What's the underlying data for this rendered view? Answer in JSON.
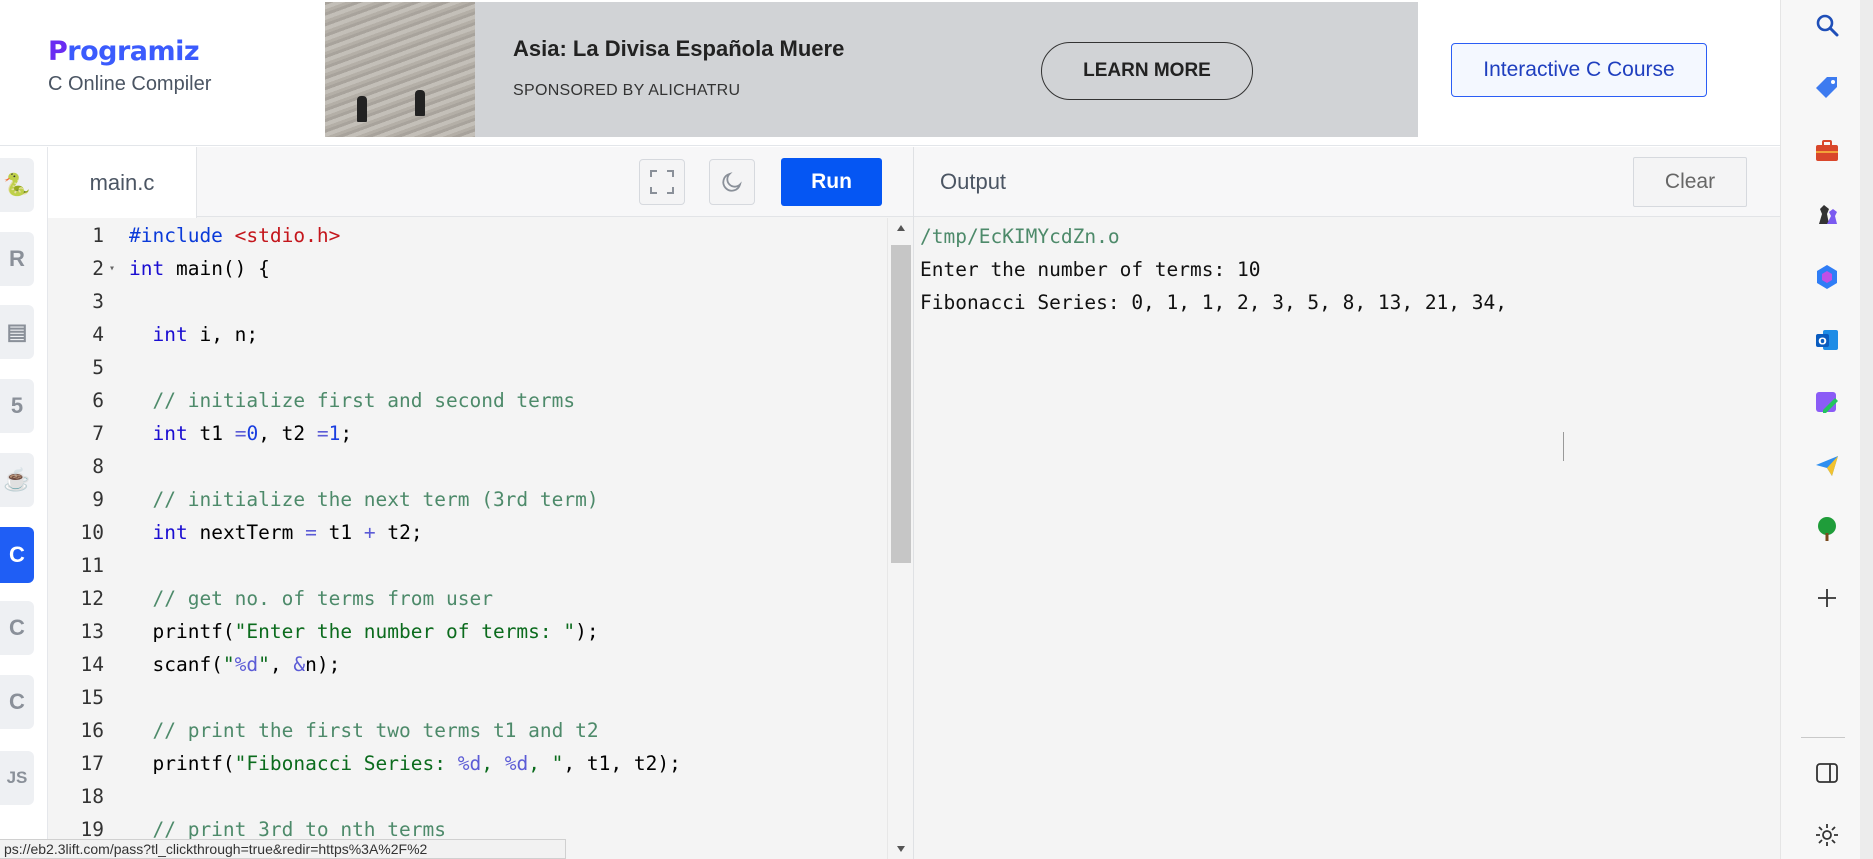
{
  "brand": {
    "name": "Programiz",
    "subtitle": "C Online Compiler"
  },
  "ad": {
    "title": "Asia: La Divisa Española Muere",
    "sponsor": "SPONSORED BY ALICHATRU",
    "cta": "LEARN MORE"
  },
  "header": {
    "course_button": "Interactive C Course"
  },
  "rail": [
    {
      "name": "python-icon",
      "glyph": "🐍",
      "active": false
    },
    {
      "name": "r-icon",
      "glyph": "R",
      "active": false
    },
    {
      "name": "sql-icon",
      "glyph": "▤",
      "active": false
    },
    {
      "name": "html-icon",
      "glyph": "5",
      "active": false
    },
    {
      "name": "java-icon",
      "glyph": "☕",
      "active": false
    },
    {
      "name": "c-icon",
      "glyph": "C",
      "active": true
    },
    {
      "name": "cpp-icon",
      "glyph": "C",
      "active": false
    },
    {
      "name": "csharp-icon",
      "glyph": "C",
      "active": false
    },
    {
      "name": "js-icon",
      "glyph": "JS",
      "active": false
    }
  ],
  "editor": {
    "tab": "main.c",
    "run_label": "Run",
    "scroll_position": 0.06,
    "scroll_visible_fraction": 0.53,
    "lines": [
      {
        "n": "1",
        "fold": false,
        "tokens": [
          [
            "pp",
            "#include "
          ],
          [
            "inc",
            "<stdio.h>"
          ]
        ]
      },
      {
        "n": "2",
        "fold": true,
        "tokens": [
          [
            "kw",
            "int"
          ],
          [
            "",
            "main() {"
          ]
        ]
      },
      {
        "n": "3",
        "fold": false,
        "tokens": []
      },
      {
        "n": "4",
        "fold": false,
        "tokens": [
          [
            "",
            "  "
          ],
          [
            "kw",
            "int"
          ],
          [
            "",
            "i, n;"
          ]
        ]
      },
      {
        "n": "5",
        "fold": false,
        "tokens": []
      },
      {
        "n": "6",
        "fold": false,
        "tokens": [
          [
            "",
            "  "
          ],
          [
            "cm",
            "// initialize first and second terms"
          ]
        ]
      },
      {
        "n": "7",
        "fold": false,
        "tokens": [
          [
            "",
            "  "
          ],
          [
            "kw",
            "int"
          ],
          [
            "",
            " t1 "
          ],
          [
            "fmt",
            "="
          ],
          [
            "",
            ""
          ],
          [
            "num",
            "0"
          ],
          [
            "",
            ", t2 "
          ],
          [
            "fmt",
            "="
          ],
          [
            "num",
            "1"
          ],
          [
            "",
            ";"
          ]
        ]
      },
      {
        "n": "8",
        "fold": false,
        "tokens": []
      },
      {
        "n": "9",
        "fold": false,
        "tokens": [
          [
            "",
            "  "
          ],
          [
            "cm",
            "// initialize the next term (3rd term)"
          ]
        ]
      },
      {
        "n": "10",
        "fold": false,
        "tokens": [
          [
            "",
            "  "
          ],
          [
            "kw",
            "int"
          ],
          [
            "",
            " nextTerm "
          ],
          [
            "fmt",
            "="
          ],
          [
            "",
            " t1 "
          ],
          [
            "fmt",
            "+"
          ],
          [
            "",
            " t2;"
          ]
        ]
      },
      {
        "n": "11",
        "fold": false,
        "tokens": []
      },
      {
        "n": "12",
        "fold": false,
        "tokens": [
          [
            "",
            "  "
          ],
          [
            "cm",
            "// get no. of terms from user"
          ]
        ]
      },
      {
        "n": "13",
        "fold": false,
        "tokens": [
          [
            "",
            "  printf("
          ],
          [
            "str",
            "\"Enter the number of terms: \""
          ],
          [
            "",
            ");"
          ]
        ]
      },
      {
        "n": "14",
        "fold": false,
        "tokens": [
          [
            "",
            "  scanf("
          ],
          [
            "str",
            "\""
          ],
          [
            "fmt",
            "%d"
          ],
          [
            "str",
            "\""
          ],
          [
            "",
            ", "
          ],
          [
            "fmt",
            "&"
          ],
          [
            "",
            "n);"
          ]
        ]
      },
      {
        "n": "15",
        "fold": false,
        "tokens": []
      },
      {
        "n": "16",
        "fold": false,
        "tokens": [
          [
            "",
            "  "
          ],
          [
            "cm",
            "// print the first two terms t1 and t2"
          ]
        ]
      },
      {
        "n": "17",
        "fold": false,
        "tokens": [
          [
            "",
            "  printf("
          ],
          [
            "str",
            "\"Fibonacci Series: "
          ],
          [
            "fmt",
            "%d"
          ],
          [
            "str",
            ", "
          ],
          [
            "fmt",
            "%d"
          ],
          [
            "str",
            ", \""
          ],
          [
            "",
            ", t1, t2);"
          ]
        ]
      },
      {
        "n": "18",
        "fold": false,
        "tokens": []
      },
      {
        "n": "19",
        "fold": false,
        "tokens": [
          [
            "",
            "  "
          ],
          [
            "cm",
            "// print 3rd to nth terms"
          ]
        ]
      }
    ]
  },
  "output": {
    "title": "Output",
    "clear_label": "Clear",
    "path": "/tmp/EcKIMYcdZn.o",
    "lines": [
      "Enter the number of terms: 10",
      "Fibonacci Series: 0, 1, 1, 2, 3, 5, 8, 13, 21, 34, "
    ]
  },
  "status_url": "ps://eb2.3lift.com/pass?tl_clickthrough=true&redir=https%3A%2F%2",
  "rightbar": [
    "search-icon",
    "tag-icon",
    "toolbox-icon",
    "chess-icon",
    "copilot-icon",
    "outlook-icon",
    "designer-icon",
    "send-icon",
    "tree-icon",
    "add-icon",
    "split-view-icon",
    "settings-icon"
  ]
}
